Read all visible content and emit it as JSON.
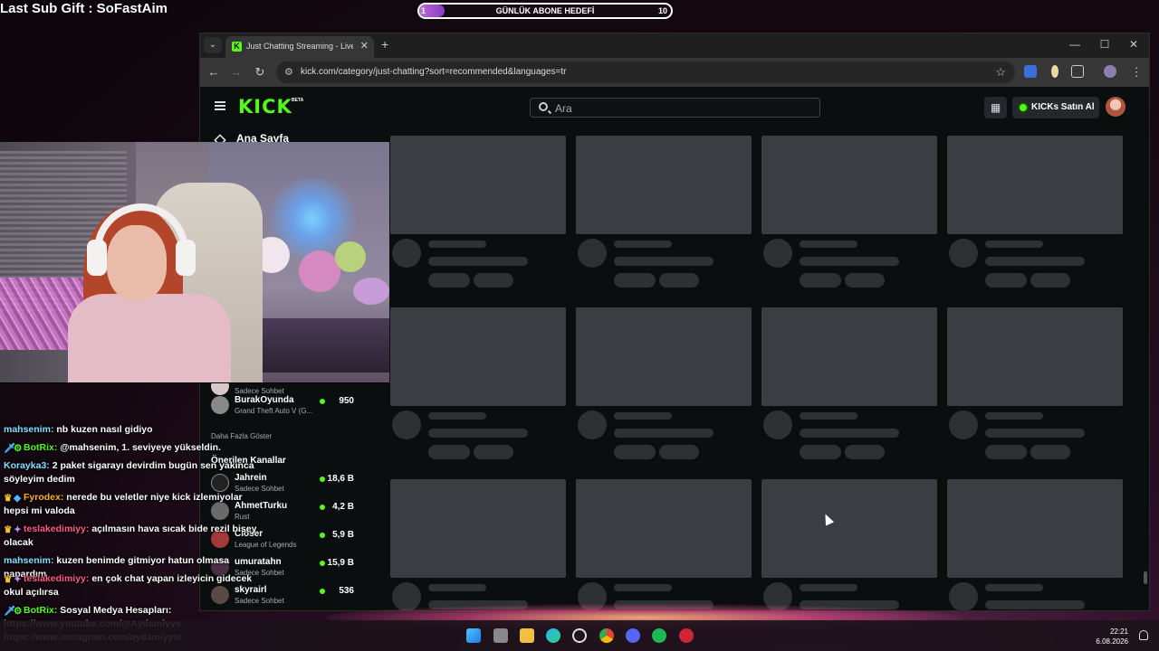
{
  "overlay": {
    "sub_gift": "Last Sub Gift : SoFastAim",
    "goal": {
      "start": "1",
      "label": "GÜNLÜK ABONE HEDEFİ",
      "end": "10",
      "progress": 0.1
    }
  },
  "browser": {
    "tab_title": "Just Chatting Streaming - Live Stre",
    "tab_favicon": "K",
    "url": "kick.com/category/just-chatting?sort=recommended&languages=tr",
    "window_controls": {
      "minimize": "—",
      "maximize": "☐",
      "close": "✕"
    }
  },
  "kick": {
    "logo": "KICK",
    "logo_badge": "BETA",
    "search_placeholder": "Ara",
    "buy_kicks": "KICKs Satın Al",
    "accent": "#53fc18"
  },
  "sidebar": {
    "home": "Ana Sayfa",
    "channels": [
      {
        "name": "",
        "category": "Sadece Sohbet",
        "viewers": ""
      },
      {
        "name": "BurakOyunda",
        "category": "Grand Theft Auto V (G...",
        "viewers": "950"
      }
    ],
    "show_more": "Daha Fazla Göster",
    "recommended_title": "Önerilen Kanallar",
    "recommended": [
      {
        "name": "Jahrein",
        "category": "Sadece Sohbet",
        "viewers": "18,6 B"
      },
      {
        "name": "AhmetTurku",
        "category": "Rust",
        "viewers": "4,2 B"
      },
      {
        "name": "Closer",
        "category": "League of Legends",
        "viewers": "5,9 B"
      },
      {
        "name": "umuratahn",
        "category": "Sadece Sohbet",
        "viewers": "15,9 B"
      },
      {
        "name": "skyrairl",
        "category": "Sadece Sohbet",
        "viewers": "536"
      }
    ]
  },
  "chat": [
    {
      "user": "mahsenim",
      "color": "#7fe0ff",
      "badges": [],
      "text": "nb kuzen nasıl gidiyo"
    },
    {
      "user": "BotRix",
      "color": "#53fc18",
      "badges": [
        "sword",
        "gear"
      ],
      "text": "@mahsenim, 1. seviyeye yükseldin."
    },
    {
      "user": "Korayka3",
      "color": "#7fe0ff",
      "badges": [],
      "text": "2 paket sigarayı devirdim bugün sen yakınca söyleyim dedim"
    },
    {
      "user": "Fyrodex",
      "color": "#ffb020",
      "badges": [
        "crown",
        "gem"
      ],
      "text": "nerede bu veletler niye kick izlemiyolar hepsi mi valoda"
    },
    {
      "user": "teslakedimiyy",
      "color": "#ff5a8a",
      "badges": [
        "crown",
        "sub"
      ],
      "text": "açılmasın hava sıcak bide rezil bisey olacak"
    },
    {
      "user": "mahsenim",
      "color": "#7fe0ff",
      "badges": [],
      "text": "kuzen benimde gitmiyor hatun olmasa napardım"
    },
    {
      "user": "teslakedimiyy",
      "color": "#ff5a8a",
      "badges": [
        "crown",
        "sub"
      ],
      "text": "en çok chat yapan izleyicin gidecek okul açılırsa"
    },
    {
      "user": "BotRix",
      "color": "#53fc18",
      "badges": [
        "sword",
        "gear"
      ],
      "text": "Sosyal Medya Hesapları: https://www.youtube.com/@Aydamiyys https://www.instagram.com/aydamiyys/"
    }
  ],
  "taskbar": {
    "time": "22:21",
    "date": "6.08.2026"
  }
}
